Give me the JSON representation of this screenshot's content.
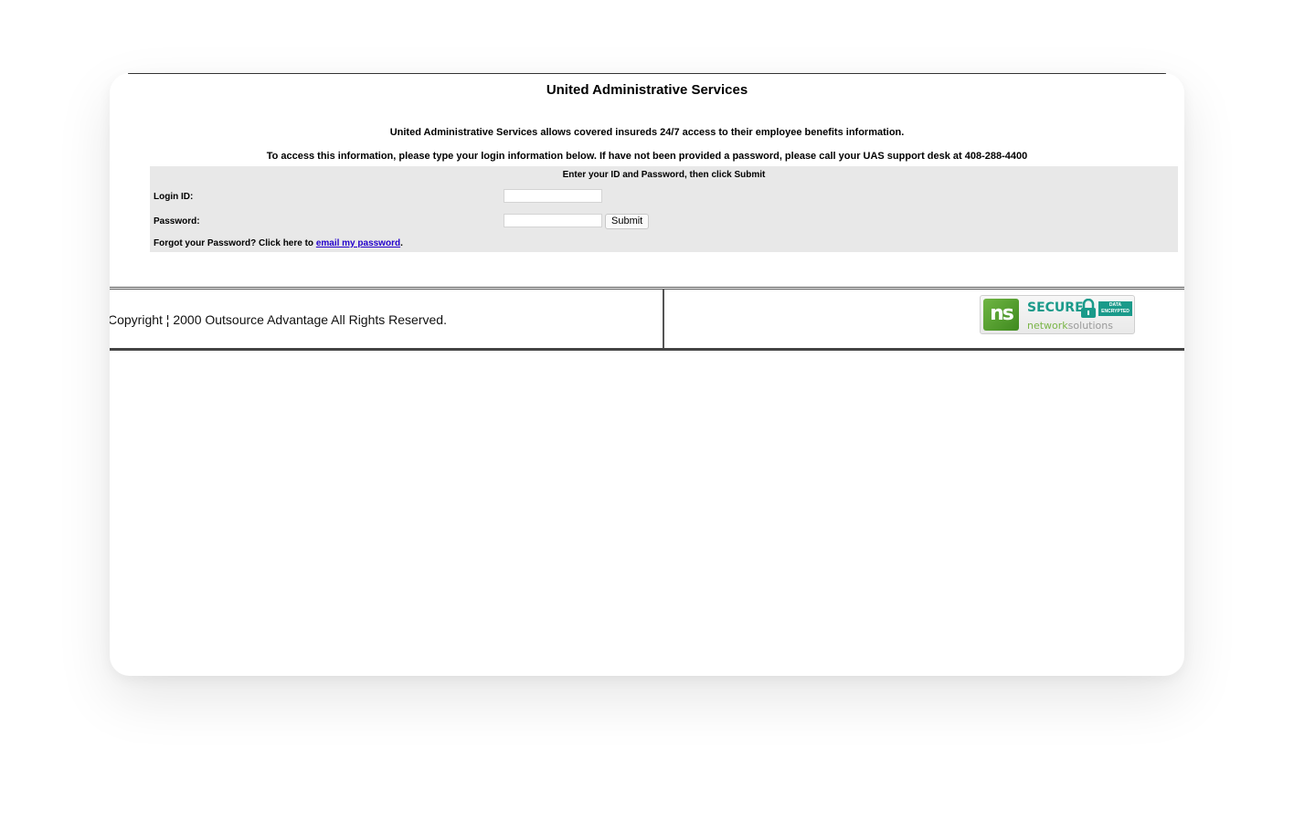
{
  "page": {
    "title": "United Administrative Services",
    "intro": "United Administrative Services  allows covered insureds 24/7 access to  their employee benefits information.",
    "instructions": "To access this information, please type your login information below. If have not been provided a password, please call your UAS support desk at 408-288-4400"
  },
  "login_form": {
    "caption": "Enter your ID and Password, then click Submit",
    "login_id_label": "Login ID:",
    "login_id_value": "",
    "password_label": "Password:",
    "password_value": "",
    "submit_label": "Submit",
    "forgot_prefix": "Forgot your Password? Click here to ",
    "forgot_link": "email my password",
    "forgot_suffix": "."
  },
  "footer": {
    "copyright": "Copyright ¦ 2000 Outsource Advantage All Rights Reserved.",
    "badge": {
      "logo_text": "ns",
      "secure_text": "SECURE",
      "encrypted_line1": "DATA",
      "encrypted_line2": "ENCRYPTED",
      "brand_bold": "network",
      "brand_light": "solutions"
    }
  },
  "colors": {
    "panel_bg": "#e8e8e8",
    "link": "#2300cc",
    "badge_teal": "#1a9a8a",
    "badge_green": "#6fb543"
  },
  "icons": [
    "lock-icon",
    "network-solutions-logo-icon"
  ]
}
